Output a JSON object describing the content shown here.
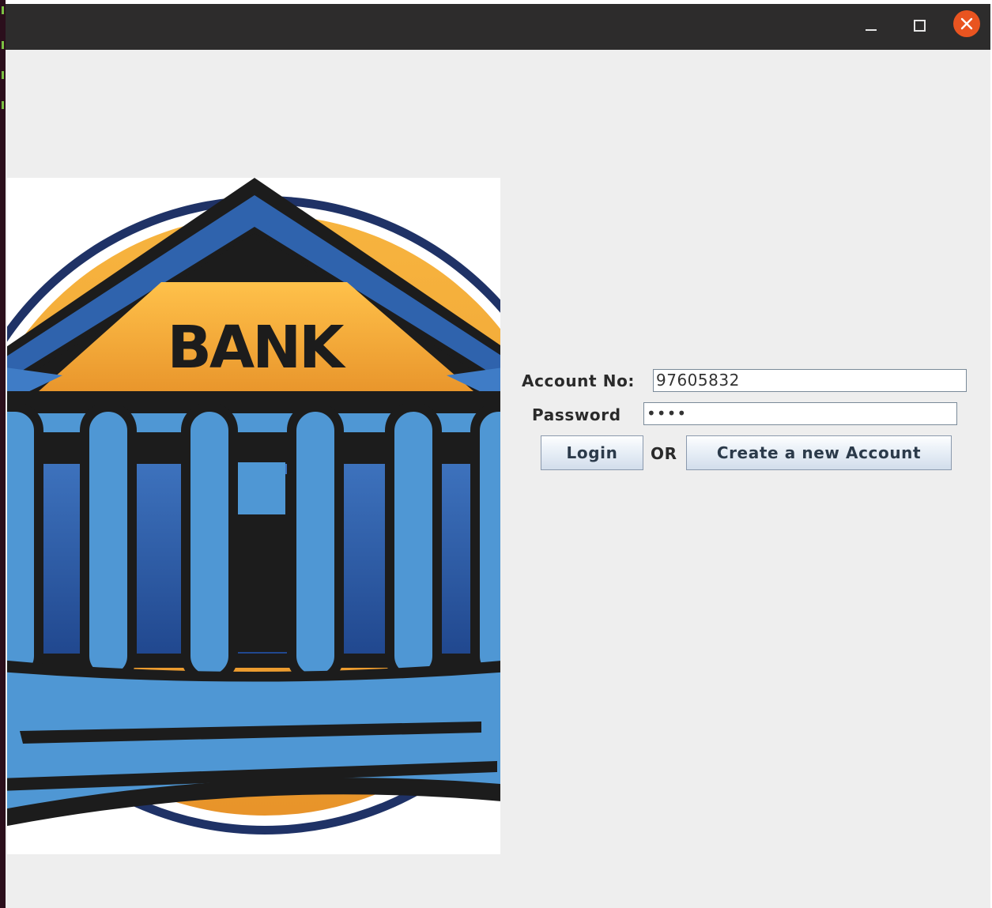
{
  "window": {
    "controls": {
      "minimize_icon": "minimize-icon",
      "maximize_icon": "maximize-icon",
      "close_icon": "close-icon"
    },
    "accent_color": "#e95420"
  },
  "logo": {
    "text": "BANK"
  },
  "form": {
    "account_label": "Account No:",
    "account_value": "97605832",
    "password_label": "Password",
    "password_value": "••••",
    "login_label": "Login",
    "or_label": "OR",
    "create_label": "Create a new Account"
  }
}
